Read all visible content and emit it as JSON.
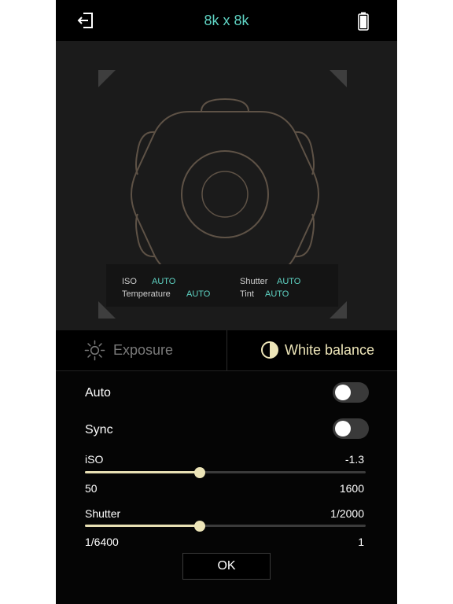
{
  "header": {
    "title": "8k x 8k",
    "back_icon": "exit-arrow-icon",
    "battery_icon": "battery-icon"
  },
  "info_panel": {
    "iso_label": "ISO",
    "iso_value": "AUTO",
    "shutter_label": "Shutter",
    "shutter_value": "AUTO",
    "temperature_label": "Temperature",
    "temperature_value": "AUTO",
    "tint_label": "Tint",
    "tint_value": "AUTO"
  },
  "modes": {
    "exposure_label": "Exposure",
    "exposure_icon": "sun-icon",
    "white_balance_label": "White balance",
    "white_balance_icon": "half-circle-contrast-icon",
    "selected": "white_balance"
  },
  "settings": {
    "auto_label": "Auto",
    "auto_on": false,
    "sync_label": "Sync",
    "sync_on": false,
    "iso": {
      "label": "iSO",
      "value": "-1.3",
      "min_label": "50",
      "max_label": "1600",
      "level": 0.41
    },
    "shutter": {
      "label": "Shutter",
      "value": "1/2000",
      "min_label": "1/6400",
      "max_label": "1",
      "level": 0.41
    },
    "ok_label": "OK"
  },
  "colors": {
    "accent": "#5fd4c4",
    "slider_fill": "#e8e0b4",
    "background": "#050505",
    "preview_background": "#1b1b1b"
  }
}
